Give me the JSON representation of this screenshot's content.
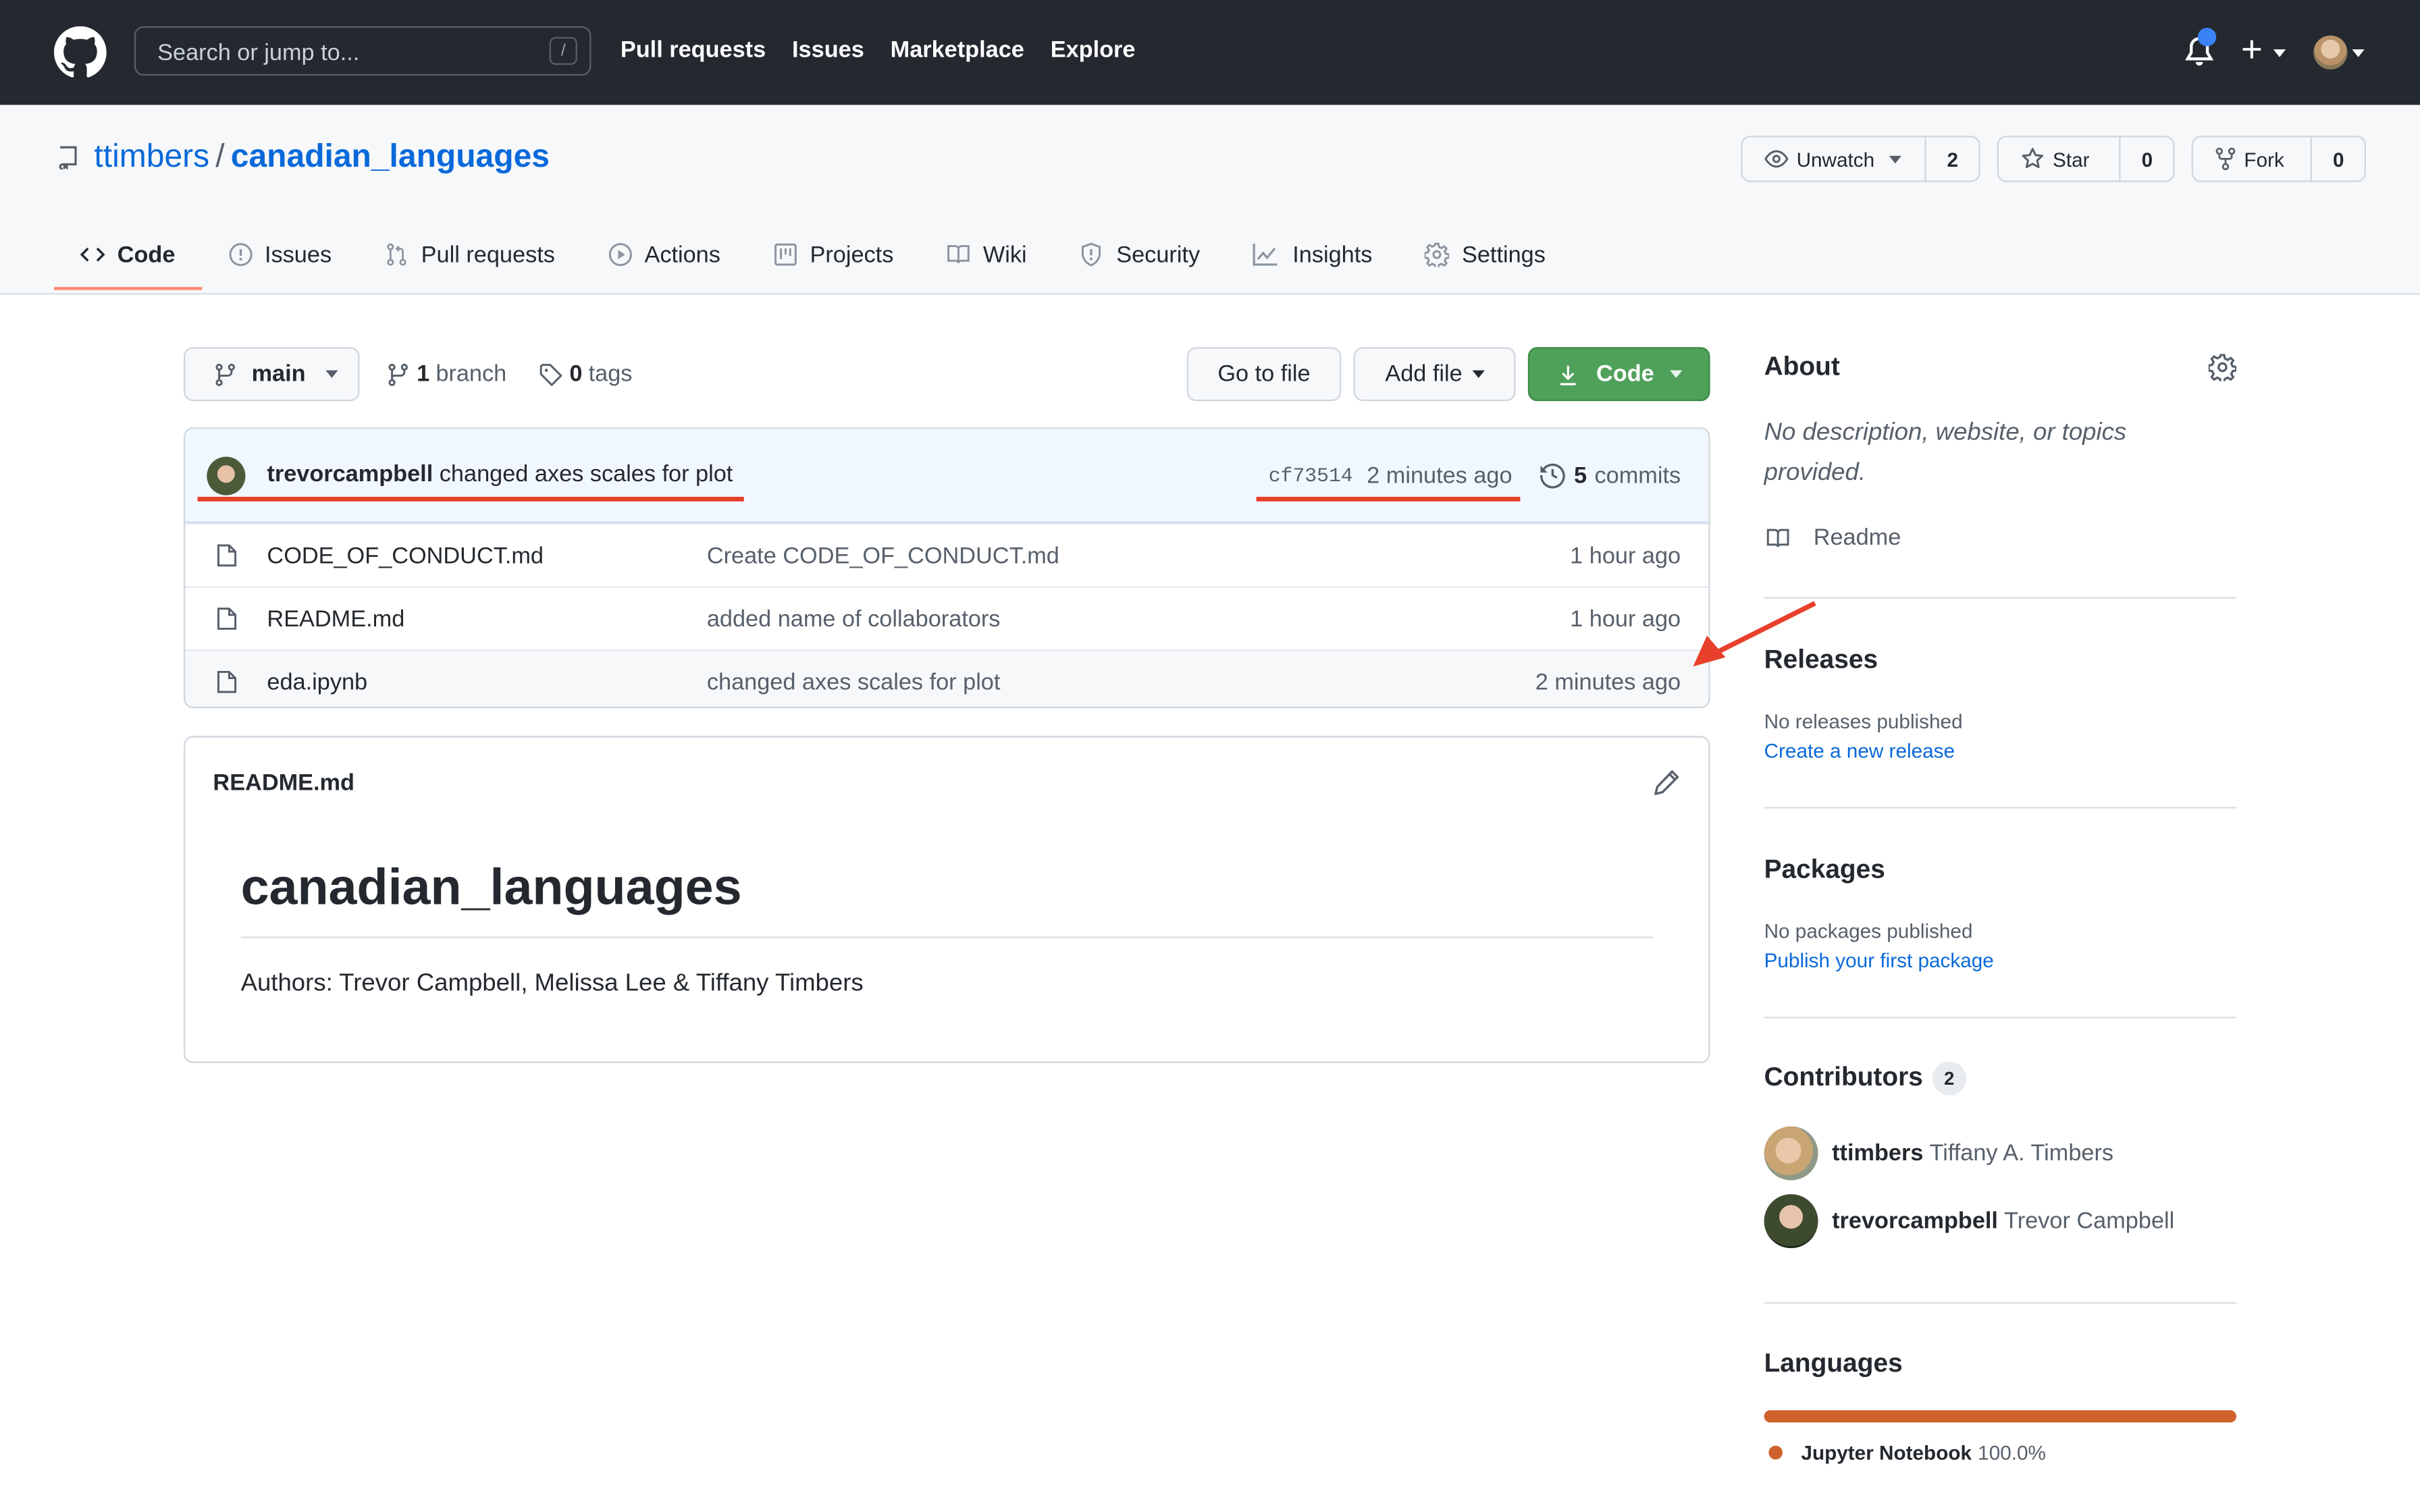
{
  "header": {
    "search_placeholder": "Search or jump to...",
    "search_shortcut": "/",
    "nav": [
      "Pull requests",
      "Issues",
      "Marketplace",
      "Explore"
    ],
    "notification_dot_color": "#3b82f6"
  },
  "repo": {
    "owner": "ttimbers",
    "separator": "/",
    "name": "canadian_languages",
    "watch": {
      "label": "Unwatch",
      "count": "2"
    },
    "star": {
      "label": "Star",
      "count": "0"
    },
    "fork": {
      "label": "Fork",
      "count": "0"
    }
  },
  "tabs": [
    {
      "label": "Code",
      "icon": "code-icon",
      "active": true
    },
    {
      "label": "Issues",
      "icon": "issue-icon"
    },
    {
      "label": "Pull requests",
      "icon": "pull-request-icon"
    },
    {
      "label": "Actions",
      "icon": "play-icon"
    },
    {
      "label": "Projects",
      "icon": "project-icon"
    },
    {
      "label": "Wiki",
      "icon": "book-icon"
    },
    {
      "label": "Security",
      "icon": "shield-icon"
    },
    {
      "label": "Insights",
      "icon": "graph-icon"
    },
    {
      "label": "Settings",
      "icon": "gear-icon"
    }
  ],
  "toolbar": {
    "branch": "main",
    "branch_count": "1",
    "branch_label": "branch",
    "tag_count": "0",
    "tag_label": "tags",
    "go_to_file": "Go to file",
    "add_file": "Add file",
    "code": "Code",
    "code_color": "#4fa15a"
  },
  "latest_commit": {
    "author": "trevorcampbell",
    "message": "changed axes scales for plot",
    "sha": "cf73514",
    "age": "2 minutes ago",
    "commit_count": "5",
    "commit_label": "commits"
  },
  "files": [
    {
      "name": "CODE_OF_CONDUCT.md",
      "message": "Create CODE_OF_CONDUCT.md",
      "age": "1 hour ago"
    },
    {
      "name": "README.md",
      "message": "added name of collaborators",
      "age": "1 hour ago"
    },
    {
      "name": "eda.ipynb",
      "message": "changed axes scales for plot",
      "age": "2 minutes ago"
    }
  ],
  "readme": {
    "filename": "README.md",
    "title": "canadian_languages",
    "body": "Authors: Trevor Campbell, Melissa Lee & Tiffany Timbers"
  },
  "sidebar": {
    "about": {
      "title": "About",
      "description": "No description, website, or topics provided.",
      "readme_link": "Readme"
    },
    "releases": {
      "title": "Releases",
      "text": "No releases published",
      "link": "Create a new release"
    },
    "packages": {
      "title": "Packages",
      "text": "No packages published",
      "link": "Publish your first package"
    },
    "contributors": {
      "title": "Contributors",
      "count": "2",
      "list": [
        {
          "login": "ttimbers",
          "name": "Tiffany A. Timbers"
        },
        {
          "login": "trevorcampbell",
          "name": "Trevor Campbell"
        }
      ]
    },
    "languages": {
      "title": "Languages",
      "list": [
        {
          "name": "Jupyter Notebook",
          "percent_label": "100.0%",
          "percent": 100,
          "color": "#cf612c"
        }
      ]
    }
  },
  "annotations": {
    "color": "#e8402a"
  }
}
